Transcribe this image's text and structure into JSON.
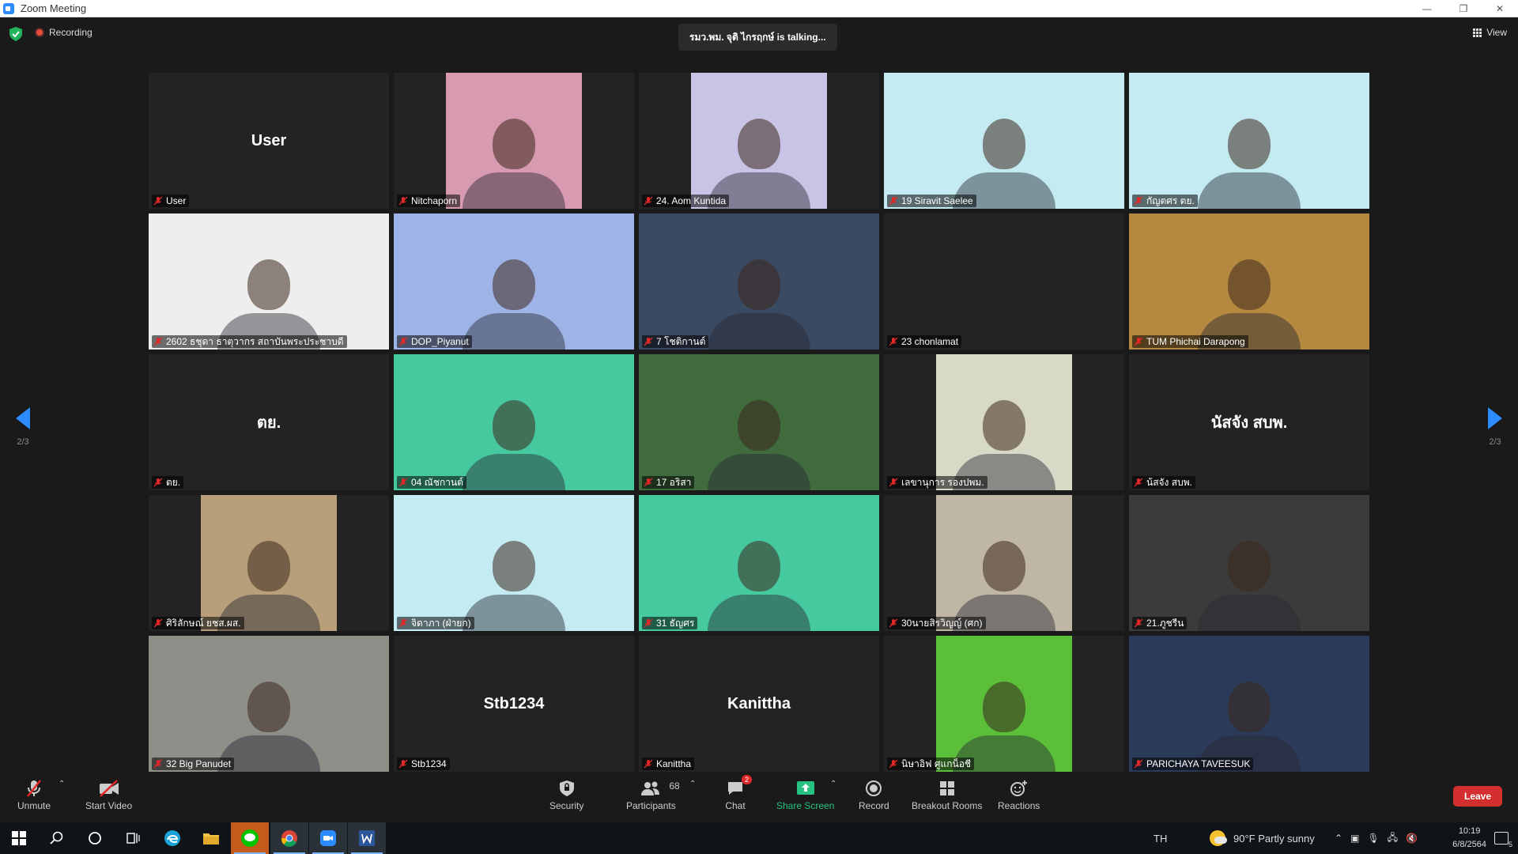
{
  "window": {
    "title": "Zoom Meeting",
    "minimize": "—",
    "restore": "❐",
    "close": "✕"
  },
  "topbar": {
    "recording": "Recording",
    "talking": "รมว.พม. จุติ ไกรฤกษ์ is  talking...",
    "view": "View"
  },
  "gallery": {
    "tiles": [
      {
        "label": "User",
        "center_name": "User",
        "bg": "#232323"
      },
      {
        "label": "Nitchaporn",
        "video_bg": "#d89ab0"
      },
      {
        "label": "24. Aom Kuntida",
        "video_bg": "#c9c3e6"
      },
      {
        "label": "19 Siravit Saelee",
        "video_bg": "#c4ebf2"
      },
      {
        "label": "กัญตศร ตย.",
        "video_bg": "#c4ebf2"
      },
      {
        "label": "2602 ธชุดา ธาตุวากร สถาบันพระประชาบดี",
        "video_bg": "#eeeeee"
      },
      {
        "label": "DOP_Piyanut",
        "video_bg": "#9fb4e6"
      },
      {
        "label": "7 โชติกานต์",
        "video_bg": "#3a4a63"
      },
      {
        "label": "23 chonlamat",
        "bg": "#232323"
      },
      {
        "label": "TUM Phichai Darapong",
        "video_bg": "#b5893f"
      },
      {
        "label": "ตย.",
        "center_name": "ตย.",
        "bg": "#232323"
      },
      {
        "label": "04 ณัชกานต์",
        "video_bg": "#47c9a0"
      },
      {
        "label": "17 อริสา",
        "video_bg": "#3f6b3d"
      },
      {
        "label": "เลขานุการ รองปพม.",
        "video_bg": "#d9d9c8"
      },
      {
        "label": "น้สจัง สบพ.",
        "center_name": "นัสจัง สบพ.",
        "bg": "#232323"
      },
      {
        "label": "ศิริลักษณ์ ยชส.ผส.",
        "video_bg": "#b89f7a"
      },
      {
        "label": "จิดาภา (ฝ่ายก)",
        "video_bg": "#c4ebf2"
      },
      {
        "label": "31 ธัญศร",
        "video_bg": "#47c9a0"
      },
      {
        "label": "30นายสิรวิญญ์ (ศก)",
        "video_bg": "#bfb7a4"
      },
      {
        "label": "21.ภูชรีน",
        "video_bg": "#3b3b3b"
      },
      {
        "label": "32 Big Panudet",
        "video_bg": "#8f8f8a"
      },
      {
        "label": "Stb1234",
        "center_name": "Stb1234",
        "bg": "#232323"
      },
      {
        "label": "Kanittha",
        "center_name": "Kanittha",
        "bg": "#232323"
      },
      {
        "label": "นิษาอิฟ ศูแกน็อชี",
        "video_bg": "#5cbf3a"
      },
      {
        "label": "PARICHAYA TAVEESUK",
        "video_bg": "#2a3a58"
      }
    ]
  },
  "pagination": {
    "left": "2/3",
    "right": "2/3"
  },
  "toolbar": {
    "unmute": "Unmute",
    "start_video": "Start Video",
    "security": "Security",
    "participants": "Participants",
    "participants_count": "68",
    "chat": "Chat",
    "chat_badge": "2",
    "share_screen": "Share Screen",
    "record": "Record",
    "breakout": "Breakout Rooms",
    "reactions": "Reactions",
    "leave": "Leave"
  },
  "taskbar": {
    "lang": "TH",
    "weather": "90°F  Partly sunny",
    "time": "10:19",
    "date": "6/8/2564",
    "notif_count": "5"
  }
}
